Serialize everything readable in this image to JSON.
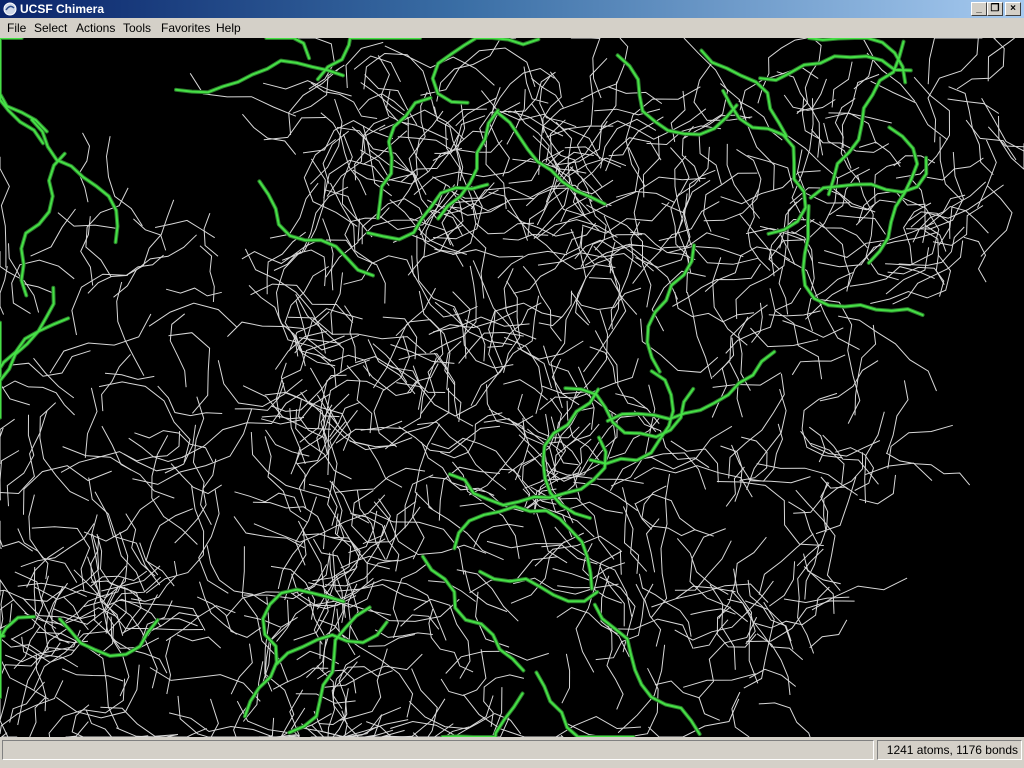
{
  "window": {
    "title": "UCSF Chimera",
    "controls": {
      "minimize": "_",
      "restore": "❐",
      "close": "×"
    }
  },
  "menubar": {
    "items": [
      "File",
      "Select",
      "Actions",
      "Tools",
      "Favorites",
      "Help"
    ]
  },
  "viewport": {
    "background_color": "#000000",
    "bond_color_default": "#d8d8d8",
    "bond_color_selected": "#46e046",
    "selection_outline_color": "#2a7a2a"
  },
  "statusbar": {
    "message": "",
    "counts": "1241 atoms, 1176 bonds"
  }
}
